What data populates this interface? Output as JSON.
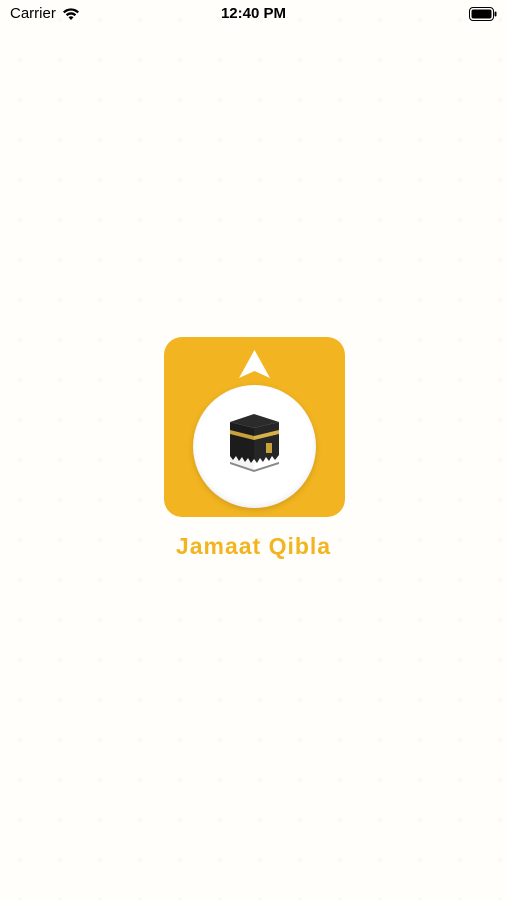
{
  "status_bar": {
    "carrier": "Carrier",
    "time": "12:40 PM"
  },
  "app": {
    "name": "Jamaat Qibla"
  },
  "icons": {
    "wifi": "wifi-icon",
    "battery": "battery-icon",
    "arrow": "direction-arrow-icon",
    "kaaba": "kaaba-icon"
  },
  "colors": {
    "brand": "#f2b521",
    "background": "#fffefb"
  }
}
